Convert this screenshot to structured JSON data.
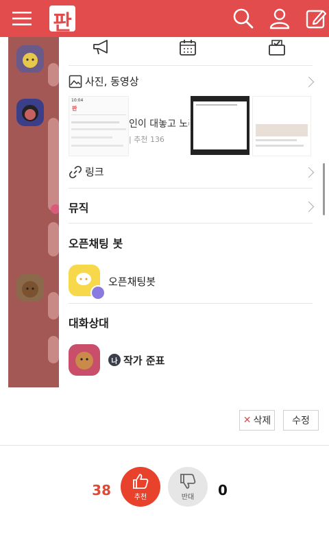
{
  "header": {
    "logo_text": "판",
    "icons": [
      "menu-icon",
      "search-icon",
      "profile-icon",
      "write-icon"
    ]
  },
  "panel": {
    "top_icons": [
      "megaphone-icon",
      "calendar-icon",
      "vote-box-icon"
    ],
    "media": {
      "label": "사진, 동영상",
      "thumb_text_1": "인이 대놓고 노리",
      "thumb_text_2": "| 추천 136",
      "mini_time": "10:04",
      "mini_logo": "판"
    },
    "link": {
      "label": "링크"
    },
    "music": {
      "label": "뮤직"
    },
    "openchat_bot": {
      "title": "오픈채팅 봇",
      "name": "오픈채팅봇"
    },
    "partner": {
      "title": "대화상대",
      "badge": "나",
      "name": "작가 준표"
    }
  },
  "actions": {
    "delete_label": "삭제",
    "edit_label": "수정"
  },
  "votes": {
    "up_count": "38",
    "up_label": "추천",
    "down_label": "반대",
    "down_count": "0"
  },
  "colors": {
    "brand": "#e24c4c",
    "vote_up": "#e8412c",
    "vote_down": "#e6e6e6",
    "count_up": "#e04a35"
  }
}
